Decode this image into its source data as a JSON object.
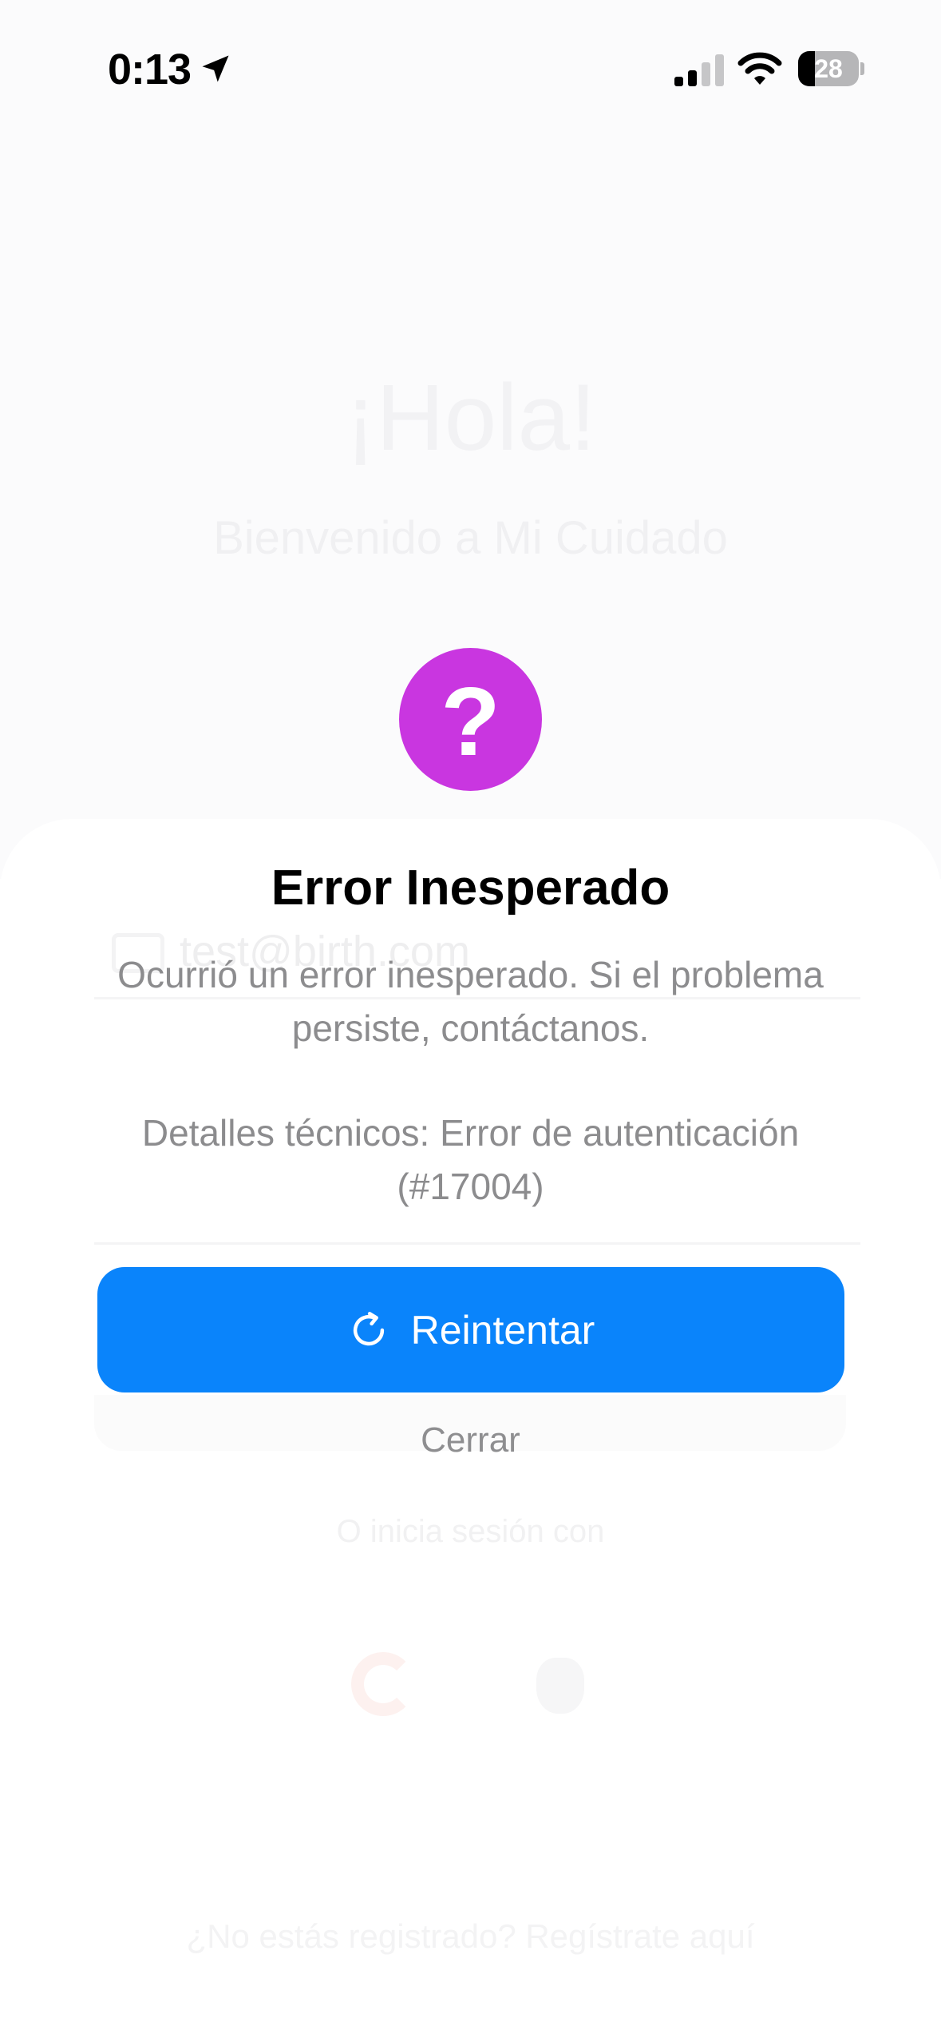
{
  "status_bar": {
    "time": "0:13",
    "battery_level": "28",
    "battery_fraction": 0.28,
    "icons": [
      "location-arrow-icon",
      "cellular-signal-icon",
      "wifi-icon",
      "battery-icon"
    ]
  },
  "background": {
    "title": "¡Hola!",
    "subtitle": "Bienvenido a Mi Cuidado",
    "email_value": "test@birth.com",
    "or_text": "O inicia sesión con",
    "register_text": "¿No estás registrado? Regístrate aquí"
  },
  "dialog": {
    "icon": "question-mark-icon",
    "icon_glyph": "?",
    "icon_color": "#c936e0",
    "title": "Error Inesperado",
    "message": "Ocurrió un error inesperado. Si el problema persiste, contáctanos.",
    "details": "Detalles técnicos: Error de autenticación (#17004)",
    "retry_label": "Reintentar",
    "retry_color": "#0a84fb",
    "close_label": "Cerrar"
  }
}
